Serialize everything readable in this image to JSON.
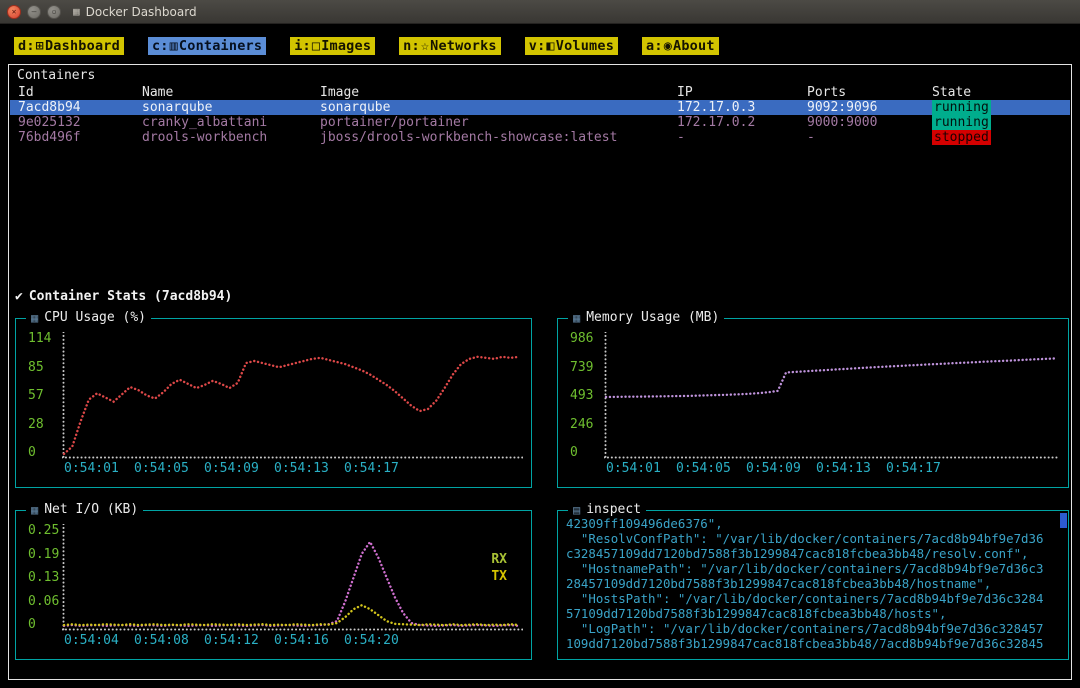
{
  "window": {
    "title": "Docker Dashboard"
  },
  "tabs": [
    {
      "key": "d",
      "icon": "⊞",
      "label": "Dashboard",
      "active": false
    },
    {
      "key": "c",
      "icon": "▥",
      "label": "Containers",
      "active": true
    },
    {
      "key": "i",
      "icon": "□",
      "label": "Images",
      "active": false
    },
    {
      "key": "n",
      "icon": "☆",
      "label": "Networks",
      "active": false
    },
    {
      "key": "v",
      "icon": "◧",
      "label": "Volumes",
      "active": false
    },
    {
      "key": "a",
      "icon": "◉",
      "label": "About",
      "active": false
    }
  ],
  "containers_panel": {
    "title": "Containers",
    "columns": [
      "Id",
      "Name",
      "Image",
      "IP",
      "Ports",
      "State"
    ],
    "rows": [
      {
        "id": "7acd8b94",
        "name": "sonarqube",
        "image": "sonarqube",
        "ip": "172.17.0.3",
        "ports": "9092:9096",
        "state": "running",
        "selected": true
      },
      {
        "id": "9e025132",
        "name": "cranky_albattani",
        "image": "portainer/portainer",
        "ip": "172.17.0.2",
        "ports": "9000:9000",
        "state": "running",
        "selected": false
      },
      {
        "id": "76bd496f",
        "name": "drools-workbench",
        "image": "jboss/drools-workbench-showcase:latest",
        "ip": "-",
        "ports": "-",
        "state": "stopped",
        "selected": false
      }
    ]
  },
  "stats_header": {
    "check": "✔",
    "label": "Container Stats (7acd8b94)"
  },
  "chart_data": [
    {
      "type": "line",
      "title": "CPU Usage (%)",
      "icon": "▦",
      "ylim": [
        0,
        114
      ],
      "yticks": [
        "114",
        "85",
        "57",
        "28",
        "0"
      ],
      "xticks": [
        "0:54:01",
        "0:54:05",
        "0:54:09",
        "0:54:13",
        "0:54:17"
      ],
      "series": [
        {
          "name": "cpu",
          "color": "#dd4848",
          "values": [
            3,
            10,
            34,
            55,
            61,
            57,
            53,
            60,
            67,
            64,
            59,
            56,
            62,
            70,
            74,
            70,
            66,
            69,
            73,
            70,
            66,
            71,
            90,
            92,
            90,
            88,
            86,
            88,
            90,
            92,
            94,
            95,
            93,
            91,
            89,
            86,
            83,
            79,
            74,
            69,
            63,
            56,
            49,
            44,
            46,
            54,
            66,
            79,
            89,
            94,
            96,
            95,
            94,
            96,
            95,
            96
          ]
        }
      ]
    },
    {
      "type": "line",
      "title": "Memory Usage (MB)",
      "icon": "▦",
      "ylim": [
        0,
        986
      ],
      "yticks": [
        "986",
        "739",
        "493",
        "246",
        "0"
      ],
      "xticks": [
        "0:54:01",
        "0:54:05",
        "0:54:09",
        "0:54:13",
        "0:54:17"
      ],
      "series": [
        {
          "name": "memory",
          "color": "#bf93dc",
          "values": [
            497,
            498,
            499,
            500,
            500,
            501,
            502,
            503,
            504,
            505,
            506,
            508,
            510,
            512,
            514,
            516,
            519,
            522,
            526,
            531,
            538,
            548,
            700,
            705,
            709,
            713,
            717,
            721,
            725,
            729,
            733,
            737,
            741,
            745,
            748,
            752,
            755,
            759,
            762,
            766,
            769,
            772,
            776,
            779,
            782,
            785,
            789,
            792,
            795,
            798,
            801,
            805,
            808,
            811,
            814,
            817
          ]
        }
      ]
    },
    {
      "type": "line",
      "title": "Net I/O (KB)",
      "icon": "▦",
      "ylim": [
        0,
        0.25
      ],
      "yticks": [
        "0.25",
        "0.19",
        "0.13",
        "0.06",
        "0"
      ],
      "xticks": [
        "0:54:04",
        "0:54:08",
        "0:54:12",
        "0:54:16",
        "0:54:20"
      ],
      "legend": [
        {
          "label": "RX",
          "color": "#a9c235"
        },
        {
          "label": "TX",
          "color": "#d7c400"
        }
      ],
      "series": [
        {
          "name": "RX",
          "color": "#cf6fcf",
          "values": [
            0.008,
            0.01,
            0.008,
            0.009,
            0.01,
            0.008,
            0.009,
            0.01,
            0.009,
            0.008,
            0.01,
            0.009,
            0.008,
            0.01,
            0.009,
            0.008,
            0.009,
            0.01,
            0.008,
            0.009,
            0.01,
            0.009,
            0.008,
            0.009,
            0.01,
            0.008,
            0.009,
            0.01,
            0.009,
            0.008,
            0.009,
            0.01,
            0.012,
            0.02,
            0.07,
            0.13,
            0.19,
            0.22,
            0.18,
            0.13,
            0.08,
            0.04,
            0.015,
            0.01,
            0.009,
            0.008,
            0.009,
            0.01,
            0.008,
            0.009,
            0.01,
            0.009,
            0.008,
            0.009,
            0.01,
            0.008
          ]
        },
        {
          "name": "TX",
          "color": "#d2c41c",
          "values": [
            0.01,
            0.012,
            0.01,
            0.011,
            0.01,
            0.012,
            0.011,
            0.01,
            0.012,
            0.01,
            0.011,
            0.012,
            0.01,
            0.011,
            0.01,
            0.012,
            0.011,
            0.01,
            0.012,
            0.011,
            0.01,
            0.012,
            0.01,
            0.011,
            0.012,
            0.01,
            0.011,
            0.01,
            0.012,
            0.011,
            0.01,
            0.012,
            0.011,
            0.015,
            0.03,
            0.05,
            0.06,
            0.05,
            0.035,
            0.02,
            0.013,
            0.012,
            0.011,
            0.01,
            0.012,
            0.011,
            0.01,
            0.012,
            0.01,
            0.011,
            0.012,
            0.01,
            0.011,
            0.01,
            0.012,
            0.01
          ]
        }
      ]
    }
  ],
  "inspect": {
    "icon": "▤",
    "title": "inspect",
    "lines": [
      "42309ff109496de6376\",",
      "  \"ResolvConfPath\": \"/var/lib/docker/containers/7acd8b94bf9e7d36",
      "c328457109dd7120bd7588f3b1299847cac818fcbea3bb48/resolv.conf\",",
      "  \"HostnamePath\": \"/var/lib/docker/containers/7acd8b94bf9e7d36c3",
      "28457109dd7120bd7588f3b1299847cac818fcbea3bb48/hostname\",",
      "  \"HostsPath\": \"/var/lib/docker/containers/7acd8b94bf9e7d36c3284",
      "57109dd7120bd7588f3b1299847cac818fcbea3bb48/hosts\",",
      "  \"LogPath\": \"/var/lib/docker/containers/7acd8b94bf9e7d36c328457",
      "109dd7120bd7588f3b1299847cac818fcbea3bb48/7acd8b94bf9e7d36c32845"
    ]
  },
  "colors": {
    "tab_yellow": "#d2c400",
    "tab_active_blue": "#5b8dd6",
    "selected_row_blue": "#3a6bc0",
    "running_badge": "#00ad8d",
    "stopped_badge": "#d40000",
    "panel_border": "#00a4a4",
    "ytick_green": "#6fbf2f",
    "xtick_cyan": "#2ab0c5",
    "inspect_text": "#3aa4c8"
  }
}
